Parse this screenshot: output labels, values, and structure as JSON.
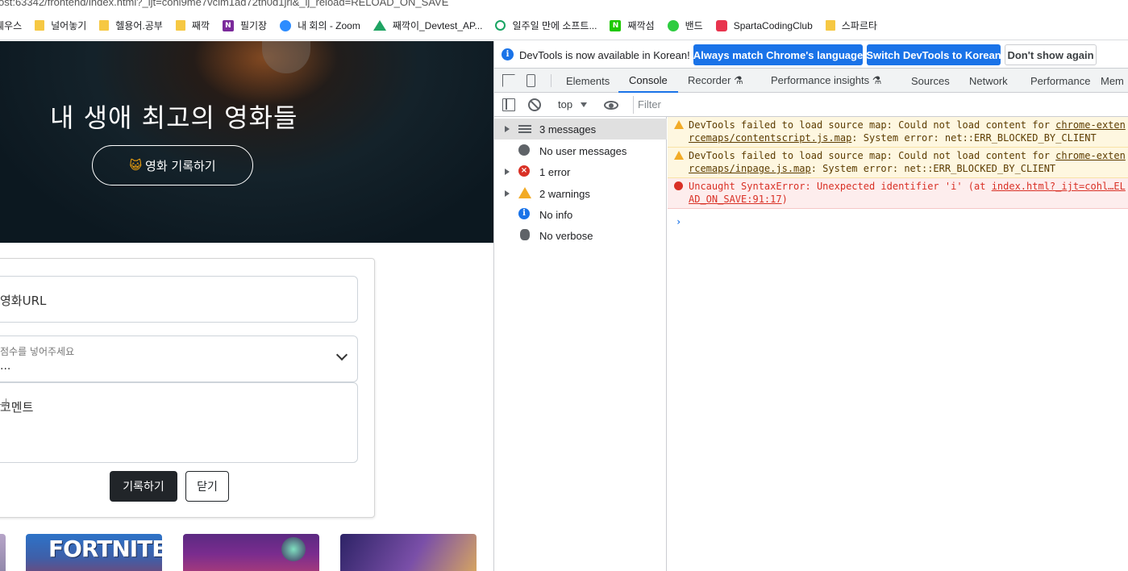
{
  "browser": {
    "url_fragment": "ost:63342/frontend/index.html?_ijt=cohl9me7vclm1ad72th0d1jri&_ij_reload=RELOAD_ON_SAVE"
  },
  "bookmarks": [
    {
      "label": "웨우스",
      "icon": "folder-icon"
    },
    {
      "label": "널어놓기",
      "icon": "folder-icon"
    },
    {
      "label": "헬용어.공부",
      "icon": "folder-icon"
    },
    {
      "label": "째깍",
      "icon": "folder-icon"
    },
    {
      "label": "필기장",
      "icon": "onenote-icon"
    },
    {
      "label": "내 회의 - Zoom",
      "icon": "zoom-icon"
    },
    {
      "label": "째깍이_Devtest_AP...",
      "icon": "drive-icon"
    },
    {
      "label": "일주일 만에 소프트...",
      "icon": "green-circle-icon"
    },
    {
      "label": "째깍섬",
      "icon": "naver-icon"
    },
    {
      "label": "밴드",
      "icon": "band-icon"
    },
    {
      "label": "SpartaCodingClub",
      "icon": "sparta-icon"
    },
    {
      "label": "스파르타",
      "icon": "folder-icon"
    }
  ],
  "page": {
    "hero_title": "내 생애 최고의 영화들",
    "record_button": "영화 기록하기",
    "record_button_emoji": "😺",
    "form": {
      "url_placeholder": "영화URL",
      "score_label": "점수를 넣어주세요",
      "score_value": "...",
      "comment_placeholder": "코멘트",
      "save_button": "기록하기",
      "close_button": "닫기"
    },
    "thumbnails": [
      {
        "title": ""
      },
      {
        "title": "FORTNITE"
      },
      {
        "title": ""
      },
      {
        "title": ""
      }
    ]
  },
  "devtools": {
    "banner": {
      "message": "DevTools is now available in Korean!",
      "btn_match": "Always match Chrome's language",
      "btn_switch": "Switch DevTools to Korean",
      "btn_dismiss": "Don't show again"
    },
    "tabs": [
      {
        "label": "Elements"
      },
      {
        "label": "Console"
      },
      {
        "label": "Recorder ⚗"
      },
      {
        "label": "Performance insights ⚗"
      },
      {
        "label": "Sources"
      },
      {
        "label": "Network"
      },
      {
        "label": "Performance"
      },
      {
        "label": "Mem"
      }
    ],
    "active_tab": "Console",
    "context": "top",
    "filter_placeholder": "Filter",
    "sidebar": [
      {
        "label": "3 messages",
        "icon": "list-icon",
        "expandable": true
      },
      {
        "label": "No user messages",
        "icon": "user-icon",
        "expandable": false
      },
      {
        "label": "1 error",
        "icon": "error-icon",
        "expandable": true
      },
      {
        "label": "2 warnings",
        "icon": "warning-icon",
        "expandable": true
      },
      {
        "label": "No info",
        "icon": "info-icon",
        "expandable": false
      },
      {
        "label": "No verbose",
        "icon": "bug-icon",
        "expandable": false
      }
    ],
    "messages": [
      {
        "level": "warning",
        "line1_pre": "DevTools failed to load source map: Could not load content for ",
        "line1_link": "chrome-exten",
        "line2_link": "rcemaps/contentscript.js.map",
        "line2_post": ": System error: net::ERR_BLOCKED_BY_CLIENT"
      },
      {
        "level": "warning",
        "line1_pre": "DevTools failed to load source map: Could not load content for ",
        "line1_link": "chrome-exten",
        "line2_link": "rcemaps/inpage.js.map",
        "line2_post": ": System error: net::ERR_BLOCKED_BY_CLIENT"
      },
      {
        "level": "error",
        "line1_pre": "Uncaught SyntaxError: Unexpected identifier 'i' (at ",
        "line1_link": "index.html?_ijt=cohl…EL",
        "line2_link": "AD_ON_SAVE:91:17",
        "line2_post": ")"
      }
    ],
    "prompt": "›"
  }
}
